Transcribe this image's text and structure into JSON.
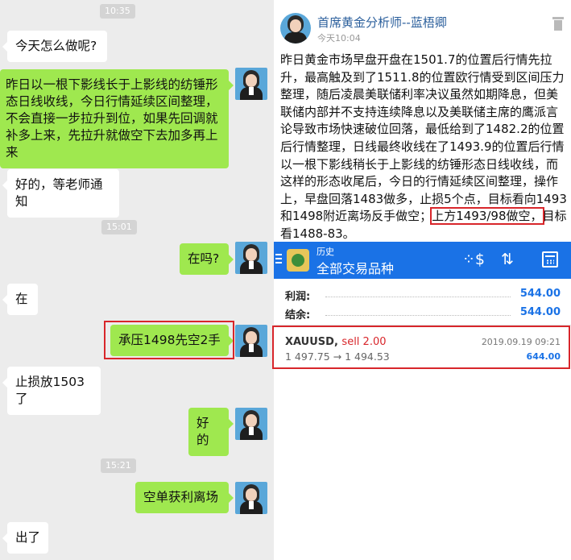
{
  "chat": {
    "time_1": "10:35",
    "time_2": "15:01",
    "time_3": "15:21",
    "messages": [
      {
        "text": "今天怎么做呢?"
      },
      {
        "text": "昨日以一根下影线长于上影线的纺锤形态日线收线，今日行情延续区间整理，不会直接一步拉升到位，如果先回调就补多上来，先拉升就做空下去加多再上来"
      },
      {
        "text": "好的，等老师通知"
      },
      {
        "text": "在吗?"
      },
      {
        "text": "在"
      },
      {
        "text": "承压1498先空2手"
      },
      {
        "text": "止损放1503了"
      },
      {
        "text": "好的"
      },
      {
        "text": "空单获利离场"
      },
      {
        "text": "出了"
      }
    ]
  },
  "post": {
    "author": "首席黄金分析师--蓝梧卿",
    "time": "今天10:04",
    "body_before": "昨日黄金市场早盘开盘在1501.7的位置后行情先拉升，最高触及到了1511.8的位置欧行情受到区间压力整理，随后凌晨美联储利率决议虽然如期降息，但美联储内部并不支持连续降息以及美联储主席的鹰派言论导致市场快速破位回落，最低给到了1482.2的位置后行情整理，日线最终收线在了1493.9的位置后行情以一根下影线稍长于上影线的纺锤形态日线收线，而这样的形态收尾后，今日的行情延续区间整理，操作上，早盘回落1483做多，止损5个点，目标看向1493和1498附近离场反手做空；",
    "body_highlight": "上方1493/98做空，",
    "body_after": "目标看1488-83。"
  },
  "trade": {
    "subtitle": "历史",
    "title": "全部交易品种",
    "profit_label": "利润:",
    "profit_value": "544.00",
    "balance_label": "结余:",
    "balance_value": "544.00",
    "deal": {
      "symbol": "XAUUSD,",
      "side": "sell 2.00",
      "datetime": "2019.09.19 09:21",
      "prices": "1 497.75 → 1 494.53",
      "profit": "644.00"
    }
  },
  "colors": {
    "chat_bg": "#ececec",
    "bubble_out": "#9fe84f",
    "highlight_red": "#d8262b",
    "app_blue": "#1a72e6",
    "author_blue": "#2b5f9c"
  }
}
